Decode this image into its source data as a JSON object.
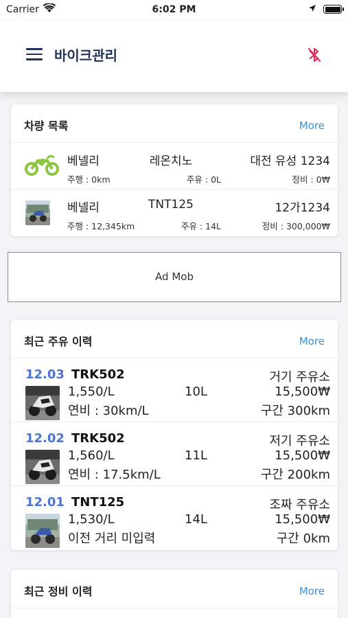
{
  "status_bar": {
    "carrier": "Carrier",
    "time": "6:02 PM"
  },
  "header": {
    "title": "바이크관리",
    "menu_icon": "hamburger-menu-icon",
    "bluetooth_icon": "bluetooth-disabled-icon",
    "bluetooth_color": "#e0305a"
  },
  "vehicles": {
    "title": "차량 목록",
    "more": "More",
    "items": [
      {
        "name": "베넬리",
        "model": "레온치노",
        "plate": "대전 유성 1234",
        "distance": "주행 : 0km",
        "fuel": "주유 : 0L",
        "maintenance": "정비 : 0₩",
        "thumb": "motorcycle-icon"
      },
      {
        "name": "베넬리",
        "model": "TNT125",
        "plate": "12가1234",
        "distance": "주행 : 12,345km",
        "fuel": "주유 : 14L",
        "maintenance": "정비 : 300,000₩",
        "thumb": "bike-photo"
      }
    ]
  },
  "ad": {
    "label": "Ad Mob"
  },
  "fuel_history": {
    "title": "최근 주유 이력",
    "more": "More",
    "items": [
      {
        "date": "12.03",
        "bike": "TRK502",
        "price": "1,550/L",
        "liters": "10L",
        "efficiency": "연비 : 30km/L",
        "station": "거기 주유소",
        "total": "15,500₩",
        "distance": "구간 300km"
      },
      {
        "date": "12.02",
        "bike": "TRK502",
        "price": "1,560/L",
        "liters": "11L",
        "efficiency": "연비 : 17.5km/L",
        "station": "저기 주유소",
        "total": "15,500₩",
        "distance": "구간 200km"
      },
      {
        "date": "12.01",
        "bike": "TNT125",
        "price": "1,530/L",
        "liters": "14L",
        "efficiency": "이전 거리 미입력",
        "station": "조짜 주유소",
        "total": "15,500₩",
        "distance": "구간 0km"
      }
    ]
  },
  "maintenance_history": {
    "title": "최근 정비 이력",
    "more": "More"
  },
  "colors": {
    "accent_blue": "#3d8fd6",
    "date_blue": "#4a73d6",
    "title_navy": "#1f3259",
    "moto_green": "#8cc63f"
  }
}
